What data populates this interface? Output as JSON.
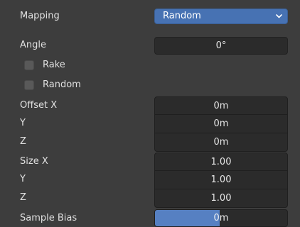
{
  "mapping": {
    "label": "Mapping",
    "value": "Random"
  },
  "angle": {
    "label": "Angle",
    "value": "0°"
  },
  "rake": {
    "label": "Rake",
    "checked": false
  },
  "random": {
    "label": "Random",
    "checked": false
  },
  "offset": {
    "x_label": "Offset X",
    "y_label": "Y",
    "z_label": "Z",
    "x": "0m",
    "y": "0m",
    "z": "0m"
  },
  "size": {
    "x_label": "Size X",
    "y_label": "Y",
    "z_label": "Z",
    "x": "1.00",
    "y": "1.00",
    "z": "1.00"
  },
  "sample_bias": {
    "label": "Sample Bias",
    "value": "0m",
    "fill_fraction": 0.49
  },
  "colors": {
    "background": "#3d3d3d",
    "field": "#2b2b2b",
    "accent": "#4772b3",
    "slider_fill": "#5680c2"
  }
}
